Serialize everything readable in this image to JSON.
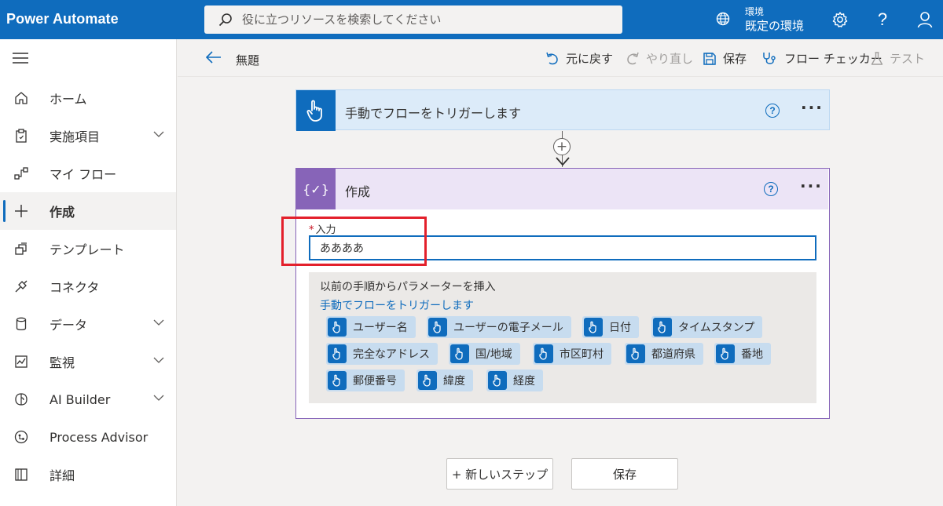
{
  "app": {
    "title": "Power Automate"
  },
  "search": {
    "placeholder": "役に立つリソースを検索してください"
  },
  "environment": {
    "label": "環境",
    "name": "既定の環境"
  },
  "sidebar": {
    "items": [
      {
        "label": "ホーム",
        "icon": "home-icon"
      },
      {
        "label": "実施項目",
        "icon": "clipboard-icon",
        "expandable": true
      },
      {
        "label": "マイ フロー",
        "icon": "flow-icon"
      },
      {
        "label": "作成",
        "icon": "plus-icon",
        "active": true
      },
      {
        "label": "テンプレート",
        "icon": "template-icon"
      },
      {
        "label": "コネクタ",
        "icon": "connector-icon"
      },
      {
        "label": "データ",
        "icon": "database-icon",
        "expandable": true
      },
      {
        "label": "監視",
        "icon": "monitor-icon",
        "expandable": true
      },
      {
        "label": "AI Builder",
        "icon": "brain-icon",
        "expandable": true
      },
      {
        "label": "Process Advisor",
        "icon": "process-advisor-icon"
      },
      {
        "label": "詳細",
        "icon": "book-icon"
      }
    ]
  },
  "commandbar": {
    "flow_name": "無題",
    "undo": "元に戻す",
    "redo": "やり直し",
    "save": "保存",
    "flow_checker": "フロー チェッカー",
    "test": "テスト"
  },
  "trigger": {
    "title": "手動でフローをトリガーします",
    "help": "?"
  },
  "compose": {
    "title": "作成",
    "help": "?",
    "icon_text": "{✓}",
    "input_label": "入力",
    "required_mark": "*",
    "input_value": "ああああ"
  },
  "dynamic_content": {
    "title": "以前の手順からパラメーターを挿入",
    "source": "手動でフローをトリガーします",
    "tokens": [
      "ユーザー名",
      "ユーザーの電子メール",
      "日付",
      "タイムスタンプ",
      "完全なアドレス",
      "国/地域",
      "市区町村",
      "都道府県",
      "番地",
      "郵便番号",
      "緯度",
      "経度"
    ]
  },
  "bottom": {
    "new_step": "+ 新しいステップ",
    "save": "保存"
  },
  "colors": {
    "brand": "#0f6cbd",
    "compose_accent": "#8764b8",
    "highlight": "#e3202b"
  }
}
